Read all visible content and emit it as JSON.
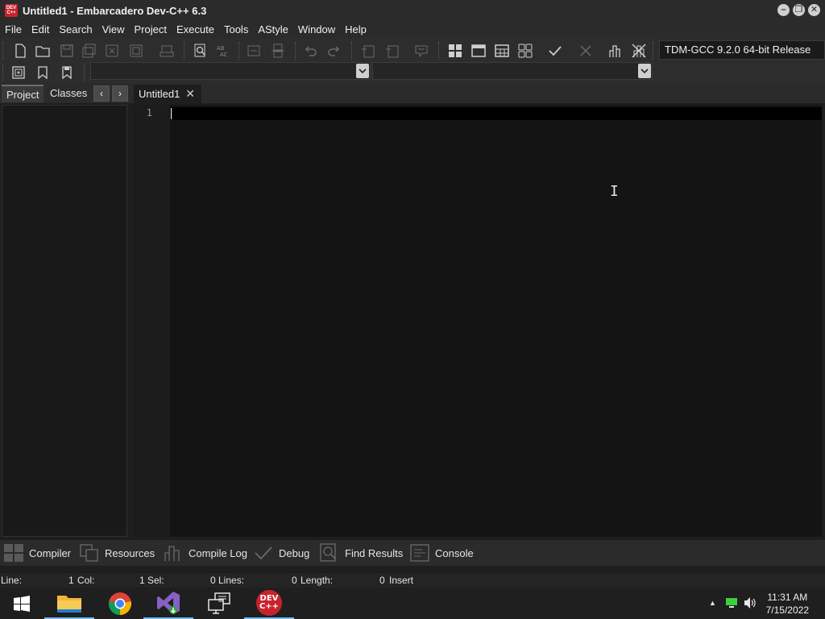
{
  "window": {
    "title": "Untitled1 - Embarcadero Dev-C++ 6.3",
    "app_icon_text": "DEV C++"
  },
  "menu": [
    "File",
    "Edit",
    "Search",
    "View",
    "Project",
    "Execute",
    "Tools",
    "AStyle",
    "Window",
    "Help"
  ],
  "toolbar": {
    "compiler": "TDM-GCC 9.2.0 64-bit Release"
  },
  "left_tabs": {
    "project": "Project",
    "classes": "Classes"
  },
  "editor": {
    "tab_label": "Untitled1",
    "line_number": "1"
  },
  "bottom_tabs": [
    "Compiler",
    "Resources",
    "Compile Log",
    "Debug",
    "Find Results",
    "Console"
  ],
  "status": {
    "line_label": "Line:",
    "line_value": "1",
    "col_label": "Col:",
    "col_value": "1",
    "sel_label": "Sel:",
    "sel_value": "0",
    "lines_label": "Lines:",
    "lines_value": "0",
    "length_label": "Length:",
    "length_value": "0",
    "mode": "Insert"
  },
  "taskbar": {
    "time": "11:31 AM",
    "date": "7/15/2022",
    "devcpp_label": "DEV C++"
  },
  "colors": {
    "accent_taskbar": "#76b9ed",
    "devcpp_red": "#c8232c"
  }
}
